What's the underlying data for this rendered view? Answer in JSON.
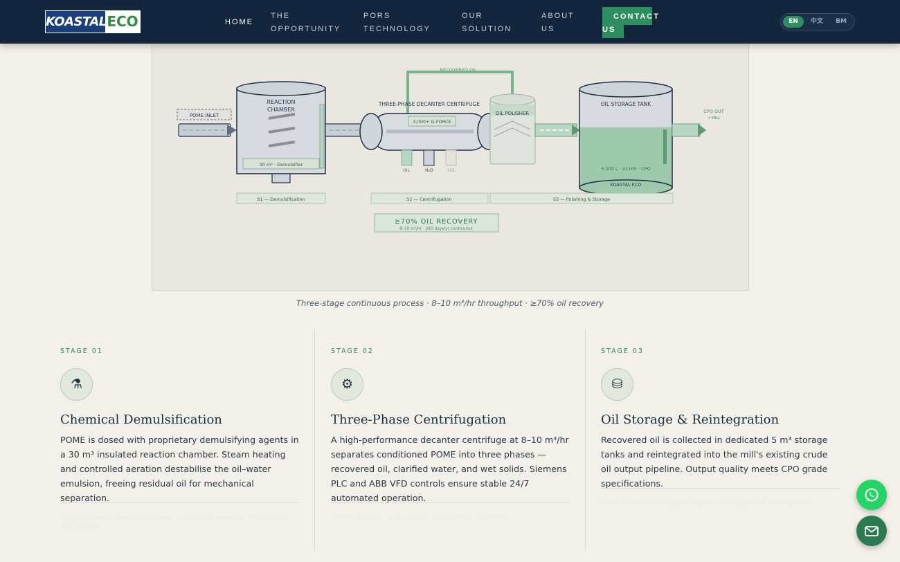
{
  "header": {
    "logo_left": "KOASTAL",
    "logo_right": "ECO",
    "nav": [
      {
        "line1": "HOME",
        "line2": ""
      },
      {
        "line1": "THE",
        "line2": "OPPORTUNITY"
      },
      {
        "line1": "PORS",
        "line2": "TECHNOLOGY"
      },
      {
        "line1": "OUR",
        "line2": "SOLUTION"
      },
      {
        "line1": "ABOUT",
        "line2": "US"
      }
    ],
    "contact": {
      "line1": "CONTACT",
      "line2": "US"
    },
    "languages": [
      "EN",
      "中文",
      "BM"
    ],
    "active_language": "EN"
  },
  "diagram": {
    "recovered_oil": "RECOVERED OIL",
    "pome_inlet": "POME INLET",
    "reaction_chamber_1": "REACTION",
    "reaction_chamber_2": "CHAMBER",
    "demulsifier": "30 m³ · Demulsifier",
    "decanter_title": "THREE-PHASE DECANTER CENTRIFUGE",
    "gforce": "3,000+ G-FORCE",
    "out_oil": "OIL",
    "out_h2o": "H₂O",
    "out_sol": "SOL",
    "oil_polisher": "OIL POLISHER",
    "storage_title": "OIL STORAGE TANK",
    "storage_spec": "5,000 L · V1105 · CPO",
    "storage_brand": "KOASTAL ECO",
    "cpo_out": "CPO OUT",
    "to_mill": "↗ MILL",
    "s1": "S1 — Demulsification",
    "s2": "S2 — Centrifugation",
    "s3": "S3 — Polishing & Storage",
    "recovery_big": "≥70% OIL RECOVERY",
    "recovery_small": "8–10 m³/hr · 280 days/yr continuous"
  },
  "caption": "Three-stage continuous process · 8–10 m³/hr throughput · ≥70% oil recovery",
  "stages": [
    {
      "label": "STAGE 01",
      "icon": "⚗",
      "icon_name": "flask-icon",
      "title": "Chemical Demulsification",
      "desc": "POME is dosed with proprietary demulsifying agents in a 30 m³ insulated reaction chamber. Steam heating and controlled aeration destabilise the oil–water emulsion, freeing residual oil for mechanical separation.",
      "meta_line1": "30 m³ insulated reaction chamber · Controlled aeration · Proprietary",
      "meta_line2": "demulsifiers"
    },
    {
      "label": "STAGE 02",
      "icon": "⚙",
      "icon_name": "gear-icon",
      "title": "Three-Phase Centrifugation",
      "desc": "A high-performance decanter centrifuge at 8–10 m³/hr separates conditioned POME into three phases — recovered oil, clarified water, and wet solids. Siemens PLC and ABB VFD controls ensure stable 24/7 automated operation.",
      "meta_line1": "3,000+ G-force · 8–10 m³/hr · Siemens PLC · ABB VFD",
      "meta_line2": ""
    },
    {
      "label": "STAGE 03",
      "icon": "⛁",
      "icon_name": "storage-tank-icon",
      "title": "Oil Storage & Reintegration",
      "desc": "Recovered oil is collected in dedicated 5 m³ storage tanks and reintegrated into the mill's existing crude oil output pipeline. Output quality meets CPO grade specifications.",
      "meta_line1": "5,000 L tanks · CPO grade output · Direct pipeline reintegration",
      "meta_line2": ""
    }
  ],
  "colors": {
    "navy": "#13263d",
    "accent_green": "#2f8e5f",
    "background": "#f3f0ea",
    "whatsapp_green": "#25d366",
    "mail_green": "#2b7a52"
  }
}
